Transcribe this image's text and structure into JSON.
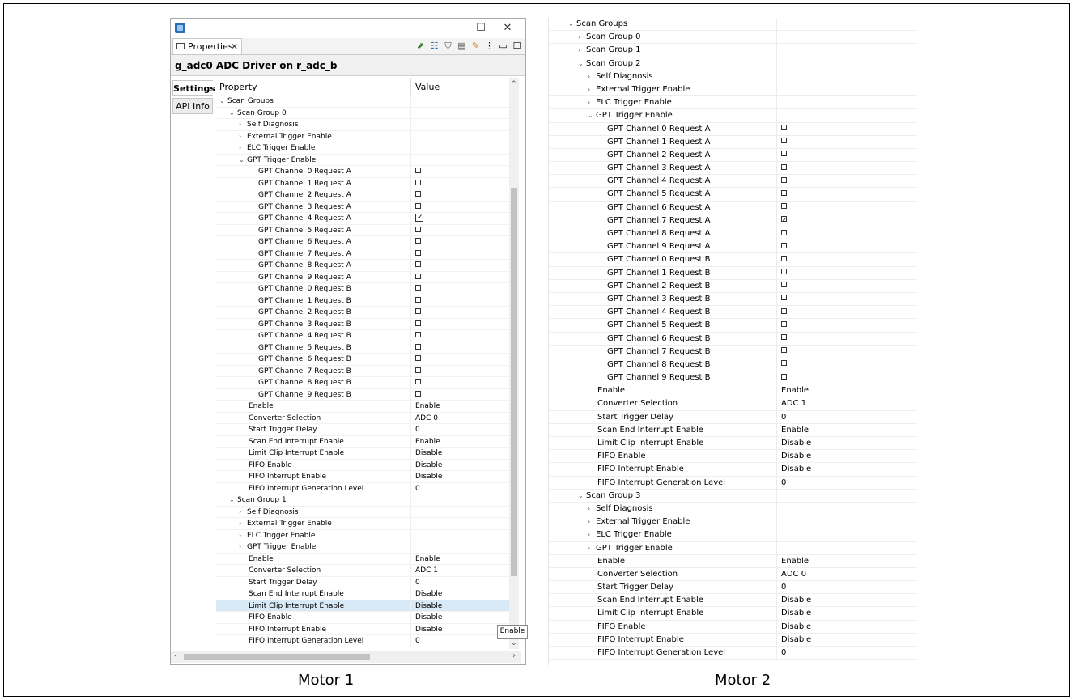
{
  "left_window": {
    "tab_label": "Properties",
    "tab_close": "✕",
    "heading": "g_adc0 ADC Driver on r_adc_b",
    "side_tabs": [
      "Settings",
      "API Info"
    ],
    "columns": {
      "property": "Property",
      "value": "Value"
    },
    "tooltip": "Enable",
    "rows": [
      {
        "label": "Scan Groups",
        "indent": 0,
        "expander": "open",
        "value": ""
      },
      {
        "label": "Scan Group 0",
        "indent": 1,
        "expander": "open",
        "value": ""
      },
      {
        "label": "Self Diagnosis",
        "indent": 2,
        "expander": "closed",
        "value": ""
      },
      {
        "label": "External Trigger Enable",
        "indent": 2,
        "expander": "closed",
        "value": ""
      },
      {
        "label": "ELC Trigger Enable",
        "indent": 2,
        "expander": "closed",
        "value": ""
      },
      {
        "label": "GPT Trigger Enable",
        "indent": 2,
        "expander": "open",
        "value": ""
      },
      {
        "label": "GPT Channel 0 Request A",
        "indent": 4,
        "checkbox": false
      },
      {
        "label": "GPT Channel 1 Request A",
        "indent": 4,
        "checkbox": false
      },
      {
        "label": "GPT Channel 2 Request A",
        "indent": 4,
        "checkbox": false
      },
      {
        "label": "GPT Channel 3 Request A",
        "indent": 4,
        "checkbox": false
      },
      {
        "label": "GPT Channel 4 Request A",
        "indent": 4,
        "checkbox": true
      },
      {
        "label": "GPT Channel 5 Request A",
        "indent": 4,
        "checkbox": false
      },
      {
        "label": "GPT Channel 6 Request A",
        "indent": 4,
        "checkbox": false
      },
      {
        "label": "GPT Channel 7 Request A",
        "indent": 4,
        "checkbox": false
      },
      {
        "label": "GPT Channel 8 Request A",
        "indent": 4,
        "checkbox": false
      },
      {
        "label": "GPT Channel 9 Request A",
        "indent": 4,
        "checkbox": false
      },
      {
        "label": "GPT Channel 0 Request B",
        "indent": 4,
        "checkbox": false
      },
      {
        "label": "GPT Channel 1 Request B",
        "indent": 4,
        "checkbox": false
      },
      {
        "label": "GPT Channel 2 Request B",
        "indent": 4,
        "checkbox": false
      },
      {
        "label": "GPT Channel 3 Request B",
        "indent": 4,
        "checkbox": false
      },
      {
        "label": "GPT Channel 4 Request B",
        "indent": 4,
        "checkbox": false
      },
      {
        "label": "GPT Channel 5 Request B",
        "indent": 4,
        "checkbox": false
      },
      {
        "label": "GPT Channel 6 Request B",
        "indent": 4,
        "checkbox": false
      },
      {
        "label": "GPT Channel 7 Request B",
        "indent": 4,
        "checkbox": false
      },
      {
        "label": "GPT Channel 8 Request B",
        "indent": 4,
        "checkbox": false
      },
      {
        "label": "GPT Channel 9 Request B",
        "indent": 4,
        "checkbox": false
      },
      {
        "label": "Enable",
        "indent": 3,
        "value": "Enable"
      },
      {
        "label": "Converter Selection",
        "indent": 3,
        "value": "ADC 0"
      },
      {
        "label": "Start Trigger Delay",
        "indent": 3,
        "value": "0"
      },
      {
        "label": "Scan End Interrupt Enable",
        "indent": 3,
        "value": "Enable"
      },
      {
        "label": "Limit Clip Interrupt Enable",
        "indent": 3,
        "value": "Disable"
      },
      {
        "label": "FIFO Enable",
        "indent": 3,
        "value": "Disable"
      },
      {
        "label": "FIFO Interrupt Enable",
        "indent": 3,
        "value": "Disable"
      },
      {
        "label": "FIFO Interrupt Generation Level",
        "indent": 3,
        "value": "0"
      },
      {
        "label": "Scan Group 1",
        "indent": 1,
        "expander": "open",
        "value": ""
      },
      {
        "label": "Self Diagnosis",
        "indent": 2,
        "expander": "closed",
        "value": ""
      },
      {
        "label": "External Trigger Enable",
        "indent": 2,
        "expander": "closed",
        "value": ""
      },
      {
        "label": "ELC Trigger Enable",
        "indent": 2,
        "expander": "closed",
        "value": ""
      },
      {
        "label": "GPT Trigger Enable",
        "indent": 2,
        "expander": "closed",
        "value": ""
      },
      {
        "label": "Enable",
        "indent": 3,
        "value": "Enable"
      },
      {
        "label": "Converter Selection",
        "indent": 3,
        "value": "ADC 1"
      },
      {
        "label": "Start Trigger Delay",
        "indent": 3,
        "value": "0"
      },
      {
        "label": "Scan End Interrupt Enable",
        "indent": 3,
        "value": "Disable"
      },
      {
        "label": "Limit Clip Interrupt Enable",
        "indent": 3,
        "value": "Disable",
        "selected": true
      },
      {
        "label": "FIFO Enable",
        "indent": 3,
        "value": "Disable"
      },
      {
        "label": "FIFO Interrupt Enable",
        "indent": 3,
        "value": "Disable"
      },
      {
        "label": "FIFO Interrupt Generation Level",
        "indent": 3,
        "value": "0"
      }
    ]
  },
  "right_panel": {
    "rows": [
      {
        "label": "Scan Groups",
        "indent": 0,
        "expander": "open",
        "value": ""
      },
      {
        "label": "Scan Group 0",
        "indent": 1,
        "expander": "closed",
        "value": ""
      },
      {
        "label": "Scan Group 1",
        "indent": 1,
        "expander": "closed",
        "value": ""
      },
      {
        "label": "Scan Group 2",
        "indent": 1,
        "expander": "open",
        "value": ""
      },
      {
        "label": "Self Diagnosis",
        "indent": 2,
        "expander": "closed",
        "value": ""
      },
      {
        "label": "External Trigger Enable",
        "indent": 2,
        "expander": "closed",
        "value": ""
      },
      {
        "label": "ELC Trigger Enable",
        "indent": 2,
        "expander": "closed",
        "value": ""
      },
      {
        "label": "GPT Trigger Enable",
        "indent": 2,
        "expander": "open",
        "value": ""
      },
      {
        "label": "GPT Channel 0 Request A",
        "indent": 4,
        "checkbox": false
      },
      {
        "label": "GPT Channel 1 Request A",
        "indent": 4,
        "checkbox": false
      },
      {
        "label": "GPT Channel 2 Request A",
        "indent": 4,
        "checkbox": false
      },
      {
        "label": "GPT Channel 3 Request A",
        "indent": 4,
        "checkbox": false
      },
      {
        "label": "GPT Channel 4 Request A",
        "indent": 4,
        "checkbox": false
      },
      {
        "label": "GPT Channel 5 Request A",
        "indent": 4,
        "checkbox": false
      },
      {
        "label": "GPT Channel 6 Request A",
        "indent": 4,
        "checkbox": false
      },
      {
        "label": "GPT Channel 7 Request A",
        "indent": 4,
        "checkbox": true
      },
      {
        "label": "GPT Channel 8 Request A",
        "indent": 4,
        "checkbox": false
      },
      {
        "label": "GPT Channel 9 Request A",
        "indent": 4,
        "checkbox": false
      },
      {
        "label": "GPT Channel 0 Request B",
        "indent": 4,
        "checkbox": false
      },
      {
        "label": "GPT Channel 1 Request B",
        "indent": 4,
        "checkbox": false
      },
      {
        "label": "GPT Channel 2 Request B",
        "indent": 4,
        "checkbox": false
      },
      {
        "label": "GPT Channel 3 Request B",
        "indent": 4,
        "checkbox": false
      },
      {
        "label": "GPT Channel 4 Request B",
        "indent": 4,
        "checkbox": false
      },
      {
        "label": "GPT Channel 5 Request B",
        "indent": 4,
        "checkbox": false
      },
      {
        "label": "GPT Channel 6 Request B",
        "indent": 4,
        "checkbox": false
      },
      {
        "label": "GPT Channel 7 Request B",
        "indent": 4,
        "checkbox": false
      },
      {
        "label": "GPT Channel 8 Request B",
        "indent": 4,
        "checkbox": false
      },
      {
        "label": "GPT Channel 9 Request B",
        "indent": 4,
        "checkbox": false
      },
      {
        "label": "Enable",
        "indent": 3,
        "value": "Enable"
      },
      {
        "label": "Converter Selection",
        "indent": 3,
        "value": "ADC 1"
      },
      {
        "label": "Start Trigger Delay",
        "indent": 3,
        "value": "0"
      },
      {
        "label": "Scan End Interrupt Enable",
        "indent": 3,
        "value": "Enable"
      },
      {
        "label": "Limit Clip Interrupt Enable",
        "indent": 3,
        "value": "Disable"
      },
      {
        "label": "FIFO Enable",
        "indent": 3,
        "value": "Disable"
      },
      {
        "label": "FIFO Interrupt Enable",
        "indent": 3,
        "value": "Disable"
      },
      {
        "label": "FIFO Interrupt Generation Level",
        "indent": 3,
        "value": "0"
      },
      {
        "label": "Scan Group 3",
        "indent": 1,
        "expander": "open",
        "value": ""
      },
      {
        "label": "Self Diagnosis",
        "indent": 2,
        "expander": "closed",
        "value": ""
      },
      {
        "label": "External Trigger Enable",
        "indent": 2,
        "expander": "closed",
        "value": ""
      },
      {
        "label": "ELC Trigger Enable",
        "indent": 2,
        "expander": "closed",
        "value": ""
      },
      {
        "label": "GPT Trigger Enable",
        "indent": 2,
        "expander": "closed",
        "value": ""
      },
      {
        "label": "Enable",
        "indent": 3,
        "value": "Enable"
      },
      {
        "label": "Converter Selection",
        "indent": 3,
        "value": "ADC 0"
      },
      {
        "label": "Start Trigger Delay",
        "indent": 3,
        "value": "0"
      },
      {
        "label": "Scan End Interrupt Enable",
        "indent": 3,
        "value": "Disable"
      },
      {
        "label": "Limit Clip Interrupt Enable",
        "indent": 3,
        "value": "Disable"
      },
      {
        "label": "FIFO Enable",
        "indent": 3,
        "value": "Disable"
      },
      {
        "label": "FIFO Interrupt Enable",
        "indent": 3,
        "value": "Disable"
      },
      {
        "label": "FIFO Interrupt Generation Level",
        "indent": 3,
        "value": "0"
      }
    ]
  },
  "captions": {
    "left": "Motor 1",
    "right": "Motor 2"
  },
  "icons": {
    "expander_open": "chevron-down-icon",
    "expander_closed": "chevron-right-icon",
    "checkbox": "checkbox-icon"
  },
  "colors": {
    "selected_row": "#d9eaf7",
    "app_icon": "#2a6fb3"
  }
}
